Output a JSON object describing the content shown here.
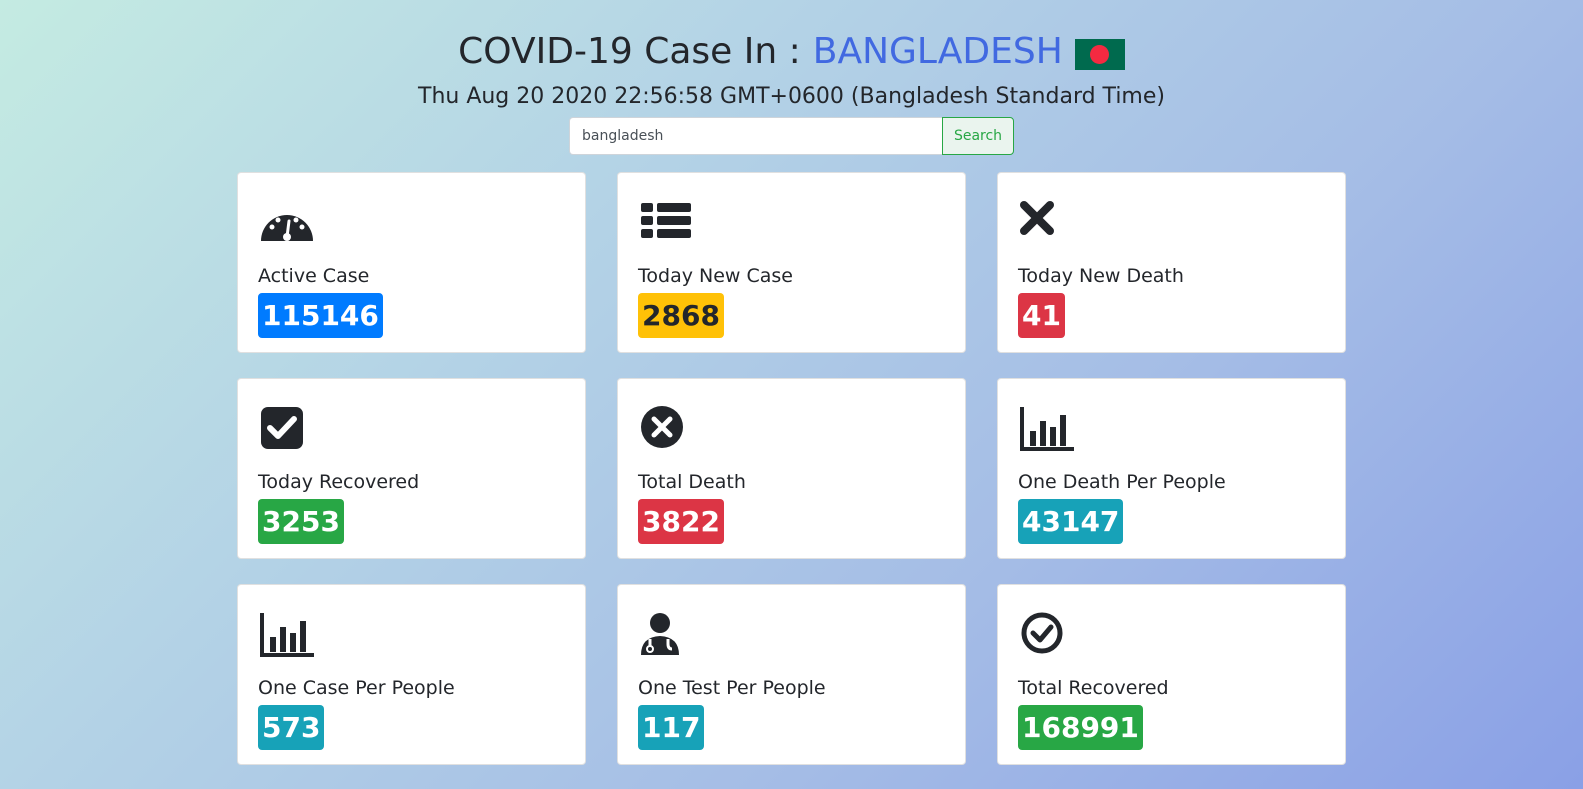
{
  "header": {
    "title_prefix": "COVID-19 Case In :",
    "country": "BANGLADESH",
    "datetime": "Thu Aug 20 2020 22:56:58 GMT+0600 (Bangladesh Standard Time)"
  },
  "search": {
    "value": "bangladesh",
    "button_label": "Search"
  },
  "cards": [
    {
      "label": "Active Case",
      "value": "115146",
      "color": "#007bff",
      "icon": "tachometer-icon"
    },
    {
      "label": "Today New Case",
      "value": "2868",
      "color": "#ffc107",
      "icon": "list-icon"
    },
    {
      "label": "Today New Death",
      "value": "41",
      "color": "#dc3545",
      "icon": "x-icon"
    },
    {
      "label": "Today Recovered",
      "value": "3253",
      "color": "#28a745",
      "icon": "check-square-icon"
    },
    {
      "label": "Total Death",
      "value": "3822",
      "color": "#dc3545",
      "icon": "times-circle-icon"
    },
    {
      "label": "One Death Per People",
      "value": "43147",
      "color": "#17a2b8",
      "icon": "bar-chart-icon"
    },
    {
      "label": "One Case Per People",
      "value": "573",
      "color": "#17a2b8",
      "icon": "bar-chart-icon"
    },
    {
      "label": "One Test Per People",
      "value": "117",
      "color": "#17a2b8",
      "icon": "doctor-icon"
    },
    {
      "label": "Total Recovered",
      "value": "168991",
      "color": "#28a745",
      "icon": "check-circle-icon"
    }
  ]
}
